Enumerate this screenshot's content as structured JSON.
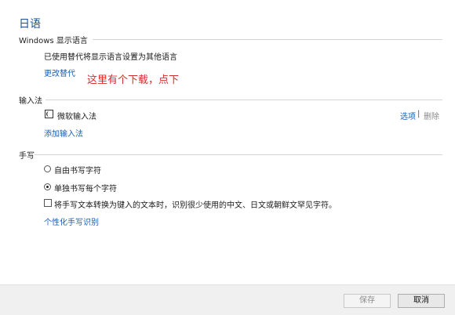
{
  "page": {
    "title": "日语",
    "annotation": "这里有个下载，点下"
  },
  "display_language": {
    "heading": "Windows 显示语言",
    "status": "已使用替代将显示语言设置为其他语言",
    "change_link": "更改替代"
  },
  "input_method": {
    "heading": "输入法",
    "items": [
      {
        "name": "微软输入法",
        "options_link": "选项",
        "separator": "|",
        "delete_link": "删除"
      }
    ],
    "add_link": "添加输入法"
  },
  "handwriting": {
    "heading": "手写",
    "options": [
      {
        "label": "自由书写字符",
        "selected": false
      },
      {
        "label": "单独书写每个字符",
        "selected": true
      }
    ],
    "checkbox_label": "将手写文本转换为键入的文本时，识别很少使用的中文、日文或朝鲜文罕见字符。",
    "checkbox_checked": false,
    "personalize_link": "个性化手写识别"
  },
  "footer": {
    "save_label": "保存",
    "cancel_label": "取消"
  }
}
